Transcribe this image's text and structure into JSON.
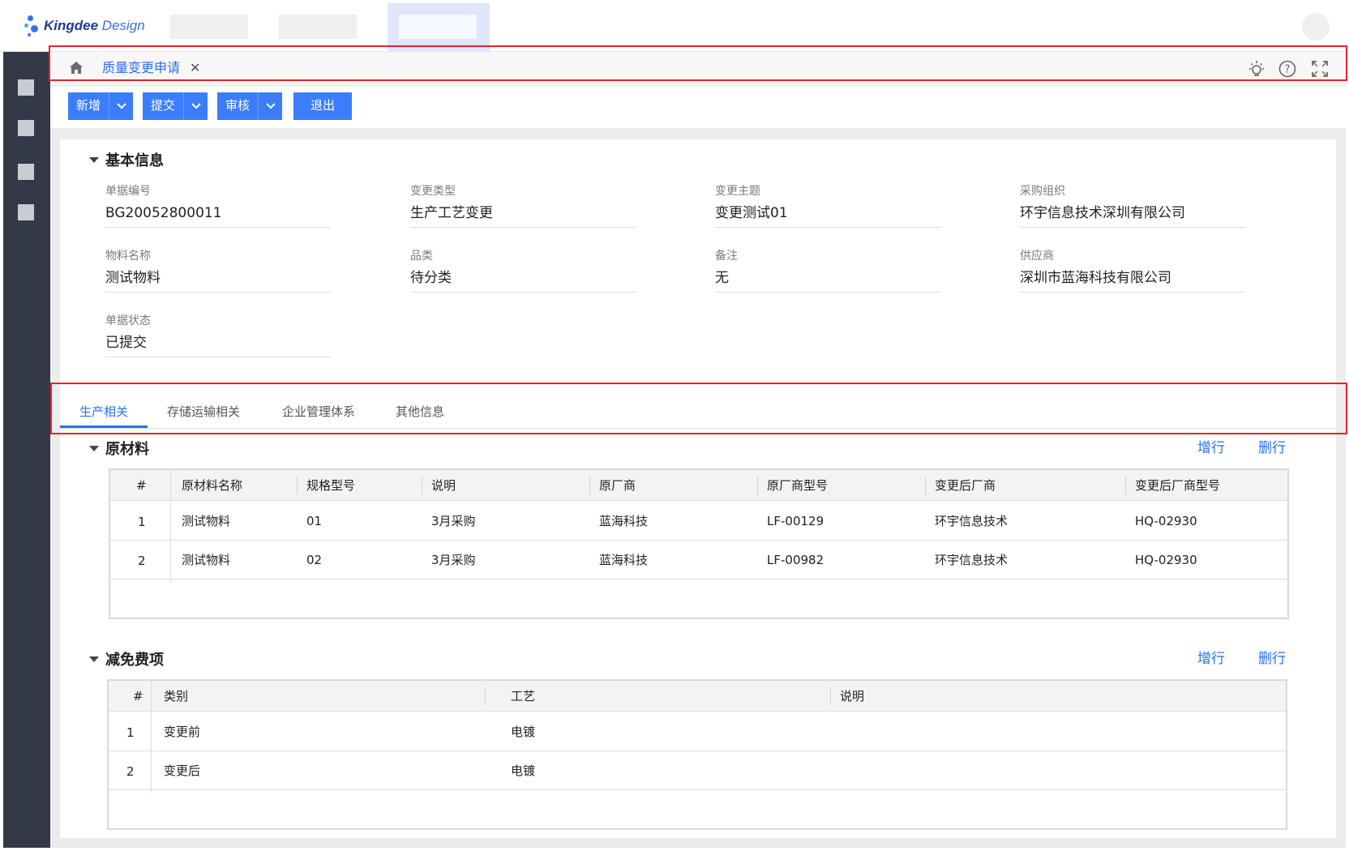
{
  "header": {
    "logo_brand": "Kingdee",
    "logo_suffix": "Design"
  },
  "tab": {
    "title": "质量变更申请",
    "close": "✕"
  },
  "toolbar": {
    "add_label": "新增",
    "submit_label": "提交",
    "audit_label": "审核",
    "exit_label": "退出"
  },
  "basic_info": {
    "title": "基本信息",
    "fields": [
      {
        "label": "单据编号",
        "value": "BG20052800011"
      },
      {
        "label": "变更类型",
        "value": "生产工艺变更"
      },
      {
        "label": "变更主题",
        "value": "变更测试01"
      },
      {
        "label": "采购组织",
        "value": "环宇信息技术深圳有限公司"
      },
      {
        "label": "物料名称",
        "value": "测试物料"
      },
      {
        "label": "品类",
        "value": "待分类"
      },
      {
        "label": "备注",
        "value": "无"
      },
      {
        "label": "供应商",
        "value": "深圳市蓝海科技有限公司"
      },
      {
        "label": "单据状态",
        "value": "已提交"
      }
    ]
  },
  "subtabs": [
    "生产相关",
    "存储运输相关",
    "企业管理体系",
    "其他信息"
  ],
  "materials": {
    "title": "原材料",
    "add_row": "增行",
    "delete_row": "删行",
    "columns": [
      "#",
      "原材料名称",
      "规格型号",
      "说明",
      "原厂商",
      "原厂商型号",
      "变更后厂商",
      "变更后厂商型号"
    ],
    "rows": [
      [
        "1",
        "测试物料",
        "01",
        "3月采购",
        "蓝海科技",
        "LF-00129",
        "环宇信息技术",
        "HQ-02930"
      ],
      [
        "2",
        "测试物料",
        "02",
        "3月采购",
        "蓝海科技",
        "LF-00982",
        "环宇信息技术",
        "HQ-02930"
      ]
    ]
  },
  "fees": {
    "title": "减免费项",
    "add_row": "增行",
    "delete_row": "删行",
    "columns": [
      "#",
      "类别",
      "工艺",
      "说明"
    ],
    "rows": [
      [
        "1",
        "变更前",
        "电镀",
        ""
      ],
      [
        "2",
        "变更后",
        "电镀",
        ""
      ]
    ]
  },
  "colors": {
    "primary": "#3b7dfc",
    "link": "#276ff5",
    "sidebar": "#34394a",
    "highlight_border": "#e8212b"
  }
}
